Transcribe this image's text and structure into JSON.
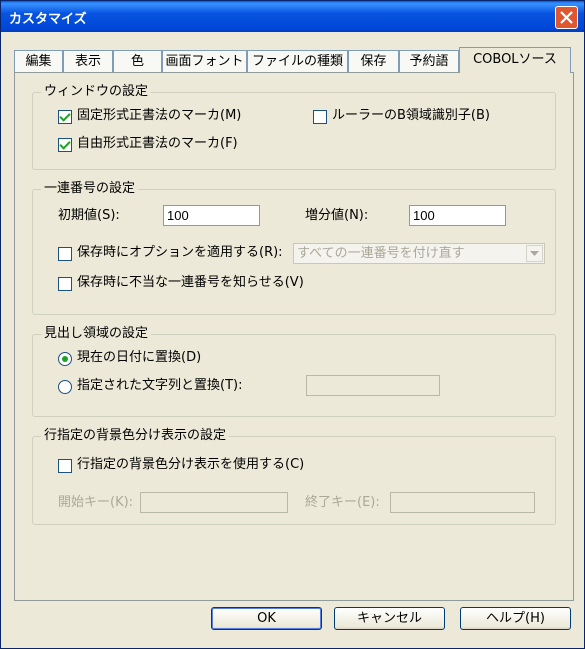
{
  "window": {
    "title": "カスタマイズ"
  },
  "tabs": [
    "編集",
    "表示",
    "色",
    "画面フォント",
    "ファイルの種類",
    "保存",
    "予約語",
    "COBOLソース"
  ],
  "window_settings": {
    "group_label": "ウィンドウの設定",
    "fixed_margin_label": "固定形式正書法のマーカ(M)",
    "fixed_margin_checked": true,
    "free_margin_label": "自由形式正書法のマーカ(F)",
    "free_margin_checked": true,
    "ruler_label": "ルーラーのB領域識別子(B)",
    "ruler_checked": false
  },
  "sequence": {
    "group_label": "一連番号の設定",
    "initial_label": "初期値(S):",
    "initial_value": "100",
    "increment_label": "増分値(N):",
    "increment_value": "100",
    "apply_on_save_label": "保存時にオプションを適用する(R):",
    "apply_on_save_checked": false,
    "option_selected": "すべての一連番号を付け直す",
    "notify_label": "保存時に不当な一連番号を知らせる(V)",
    "notify_checked": false
  },
  "heading_area": {
    "group_label": "見出し領域の設定",
    "current_date_label": "現在の日付に置換(D)",
    "specified_label": "指定された文字列と置換(T):",
    "selected": "current_date",
    "specified_value": ""
  },
  "row_bg": {
    "group_label": "行指定の背景色分け表示の設定",
    "use_label": "行指定の背景色分け表示を使用する(C)",
    "use_checked": false,
    "start_key_label": "開始キー(K):",
    "end_key_label": "終了キー(E):",
    "start_key_value": "",
    "end_key_value": ""
  },
  "buttons": {
    "ok": "OK",
    "cancel": "キャンセル",
    "help": "ヘルプ(H)"
  },
  "colors": {
    "title_bar": "#0054e3",
    "dialog_bg": "#ece9d8",
    "close_button": "#e0562e"
  }
}
